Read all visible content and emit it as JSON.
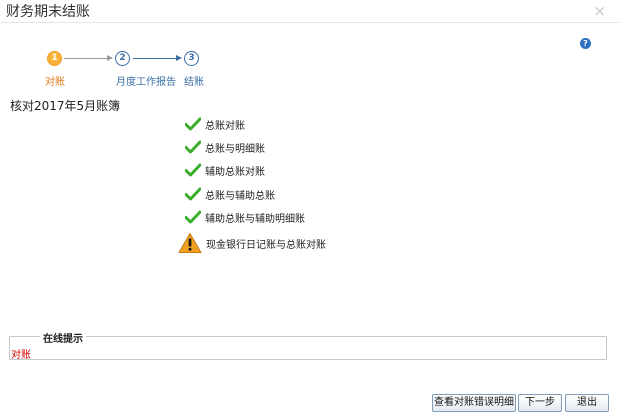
{
  "dialog": {
    "title": "财务期末结账",
    "close_label": "×",
    "help_icon_label": "?"
  },
  "steps": [
    {
      "number": "1",
      "label": "对账",
      "active": true
    },
    {
      "number": "2",
      "label": "月度工作报告",
      "active": false
    },
    {
      "number": "3",
      "label": "结账",
      "active": false
    }
  ],
  "section_title": "核对2017年5月账簿",
  "checks": [
    {
      "label": "总账对账",
      "status": "pass"
    },
    {
      "label": "总账与明细账",
      "status": "pass"
    },
    {
      "label": "辅助总账对账",
      "status": "pass"
    },
    {
      "label": "总账与辅助总账",
      "status": "pass"
    },
    {
      "label": "辅助总账与辅助明细账",
      "status": "pass"
    },
    {
      "label": "现金银行日记账与总账对账",
      "status": "warning"
    }
  ],
  "tips": {
    "legend": "在线提示",
    "text": "对账"
  },
  "buttons": {
    "view_errors": "查看对账错误明细",
    "next": "下一步",
    "exit": "退出"
  },
  "colors": {
    "active_step": "#f7b23a",
    "step_blue": "#3c6ea8",
    "check_green": "#3aae2c",
    "warning_orange": "#f0a020",
    "tip_red": "#d50000"
  }
}
